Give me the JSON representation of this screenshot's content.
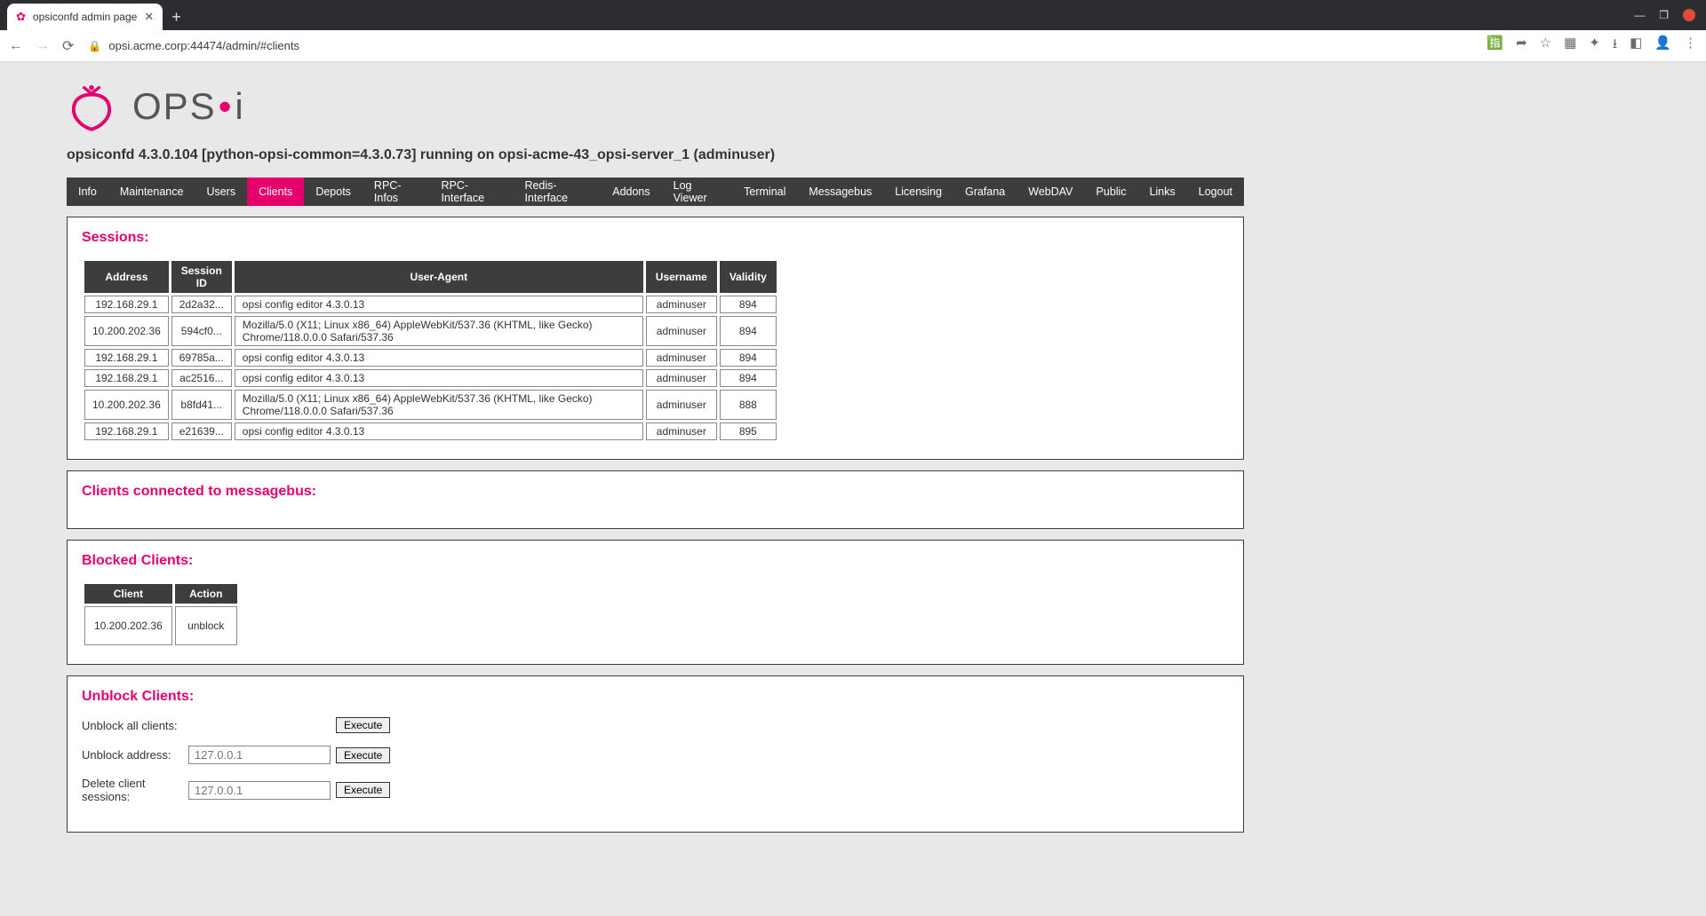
{
  "browser": {
    "tab_title": "opsiconfd admin page",
    "url": "opsi.acme.corp:44474/admin/#clients"
  },
  "logo_text_a": "OPS",
  "logo_text_b": "i",
  "subtitle": "opsiconfd 4.3.0.104 [python-opsi-common=4.3.0.73] running on opsi-acme-43_opsi-server_1 (adminuser)",
  "nav": [
    "Info",
    "Maintenance",
    "Users",
    "Clients",
    "Depots",
    "RPC-Infos",
    "RPC-Interface",
    "Redis-Interface",
    "Addons",
    "Log Viewer",
    "Terminal",
    "Messagebus",
    "Licensing",
    "Grafana",
    "WebDAV",
    "Public",
    "Links",
    "Logout"
  ],
  "nav_active_index": 3,
  "sessions": {
    "heading": "Sessions:",
    "columns": [
      "Address",
      "Session ID",
      "User-Agent",
      "Username",
      "Validity"
    ],
    "rows": [
      {
        "addr": "192.168.29.1",
        "sid": "2d2a32...",
        "ua": "opsi config editor 4.3.0.13",
        "user": "adminuser",
        "val": "894"
      },
      {
        "addr": "10.200.202.36",
        "sid": "594cf0...",
        "ua": "Mozilla/5.0 (X11; Linux x86_64) AppleWebKit/537.36 (KHTML, like Gecko) Chrome/118.0.0.0 Safari/537.36",
        "user": "adminuser",
        "val": "894"
      },
      {
        "addr": "192.168.29.1",
        "sid": "69785a...",
        "ua": "opsi config editor 4.3.0.13",
        "user": "adminuser",
        "val": "894"
      },
      {
        "addr": "192.168.29.1",
        "sid": "ac2516...",
        "ua": "opsi config editor 4.3.0.13",
        "user": "adminuser",
        "val": "894"
      },
      {
        "addr": "10.200.202.36",
        "sid": "b8fd41...",
        "ua": "Mozilla/5.0 (X11; Linux x86_64) AppleWebKit/537.36 (KHTML, like Gecko) Chrome/118.0.0.0 Safari/537.36",
        "user": "adminuser",
        "val": "888"
      },
      {
        "addr": "192.168.29.1",
        "sid": "e21639...",
        "ua": "opsi config editor 4.3.0.13",
        "user": "adminuser",
        "val": "895"
      }
    ]
  },
  "msgbus": {
    "heading": "Clients connected to messagebus:"
  },
  "blocked": {
    "heading": "Blocked Clients:",
    "columns": [
      "Client",
      "Action"
    ],
    "rows": [
      {
        "client": "10.200.202.36",
        "action": "unblock"
      }
    ]
  },
  "unblock": {
    "heading": "Unblock Clients:",
    "rows": {
      "all_label": "Unblock all clients:",
      "addr_label": "Unblock address:",
      "delete_label": "Delete client sessions:",
      "placeholder": "127.0.0.1",
      "execute": "Execute"
    }
  }
}
